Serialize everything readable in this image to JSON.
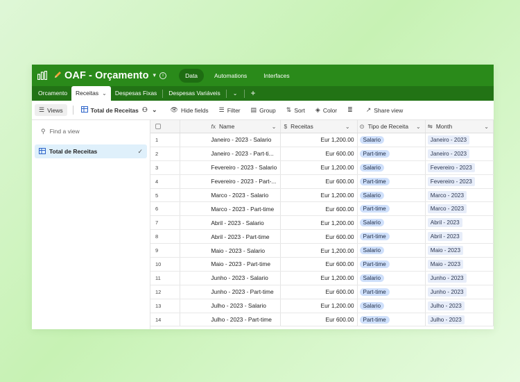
{
  "app": {
    "title": "OAF - Orçamento",
    "top_tabs": [
      "Data",
      "Automations",
      "Interfaces"
    ],
    "accent": "#2a8a1a"
  },
  "table_tabs": [
    "Orcamento",
    "Receitas",
    "Despesas Fixas",
    "Despesas Variáveis"
  ],
  "toolbar": {
    "views": "Views",
    "view_name": "Total de Receitas",
    "hide_fields": "Hide fields",
    "filter": "Filter",
    "group": "Group",
    "sort": "Sort",
    "color": "Color",
    "share": "Share view"
  },
  "sidebar": {
    "find_placeholder": "Find a view",
    "view_item": "Total de Receitas"
  },
  "columns": {
    "name": "Name",
    "receitas": "Receitas",
    "tipo": "Tipo de Receita",
    "month": "Month"
  },
  "rows": [
    {
      "n": "1",
      "name": "Janeiro - 2023 - Salario",
      "rec": "Eur 1,200.00",
      "tipo": "Salario",
      "month": "Janeiro - 2023"
    },
    {
      "n": "2",
      "name": "Janeiro - 2023 - Part-ti...",
      "rec": "Eur 600.00",
      "tipo": "Part-time",
      "month": "Janeiro - 2023"
    },
    {
      "n": "3",
      "name": "Fevereiro - 2023 - Salario",
      "rec": "Eur 1,200.00",
      "tipo": "Salario",
      "month": "Fevereiro - 2023"
    },
    {
      "n": "4",
      "name": "Fevereiro - 2023 - Part-...",
      "rec": "Eur 600.00",
      "tipo": "Part-time",
      "month": "Fevereiro - 2023"
    },
    {
      "n": "5",
      "name": "Marco - 2023 - Salario",
      "rec": "Eur 1,200.00",
      "tipo": "Salario",
      "month": "Marco - 2023"
    },
    {
      "n": "6",
      "name": "Marco - 2023 - Part-time",
      "rec": "Eur 600.00",
      "tipo": "Part-time",
      "month": "Marco - 2023"
    },
    {
      "n": "7",
      "name": "Abril - 2023 - Salario",
      "rec": "Eur 1,200.00",
      "tipo": "Salario",
      "month": "Abril - 2023"
    },
    {
      "n": "8",
      "name": "Abril - 2023 - Part-time",
      "rec": "Eur 600.00",
      "tipo": "Part-time",
      "month": "Abril - 2023"
    },
    {
      "n": "9",
      "name": "Maio - 2023 - Salario",
      "rec": "Eur 1,200.00",
      "tipo": "Salario",
      "month": "Maio - 2023"
    },
    {
      "n": "10",
      "name": "Maio - 2023 - Part-time",
      "rec": "Eur 600.00",
      "tipo": "Part-time",
      "month": "Maio - 2023"
    },
    {
      "n": "11",
      "name": "Junho - 2023 - Salario",
      "rec": "Eur 1,200.00",
      "tipo": "Salario",
      "month": "Junho - 2023"
    },
    {
      "n": "12",
      "name": "Junho - 2023 - Part-time",
      "rec": "Eur 600.00",
      "tipo": "Part-time",
      "month": "Junho - 2023"
    },
    {
      "n": "13",
      "name": "Julho - 2023 - Salario",
      "rec": "Eur 1,200.00",
      "tipo": "Salario",
      "month": "Julho - 2023"
    },
    {
      "n": "14",
      "name": "Julho - 2023 - Part-time",
      "rec": "Eur 600.00",
      "tipo": "Part-time",
      "month": "Julho - 2023"
    }
  ]
}
